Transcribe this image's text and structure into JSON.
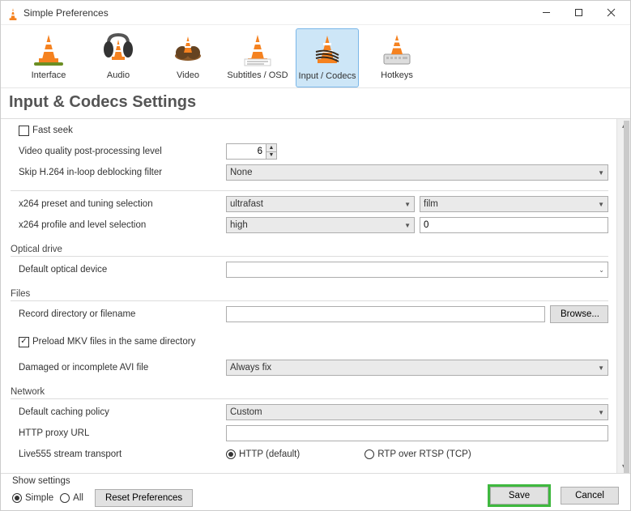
{
  "window": {
    "title": "Simple Preferences"
  },
  "categories": {
    "interface": "Interface",
    "audio": "Audio",
    "video": "Video",
    "subtitles": "Subtitles / OSD",
    "input_codecs": "Input / Codecs",
    "hotkeys": "Hotkeys"
  },
  "heading": "Input & Codecs Settings",
  "settings": {
    "fast_seek_label": "Fast seek",
    "video_quality_label": "Video quality post-processing level",
    "video_quality_value": "6",
    "skip_h264_label": "Skip H.264 in-loop deblocking filter",
    "skip_h264_value": "None",
    "x264_preset_label": "x264 preset and tuning selection",
    "x264_preset_value": "ultrafast",
    "x264_tune_value": "film",
    "x264_profile_label": "x264 profile and level selection",
    "x264_profile_value": "high",
    "x264_level_value": "0"
  },
  "optical": {
    "group": "Optical drive",
    "default_device_label": "Default optical device",
    "default_device_value": ""
  },
  "files": {
    "group": "Files",
    "record_dir_label": "Record directory or filename",
    "record_dir_value": "",
    "browse": "Browse...",
    "preload_mkv_label": "Preload MKV files in the same directory",
    "damaged_avi_label": "Damaged or incomplete AVI file",
    "damaged_avi_value": "Always fix"
  },
  "network": {
    "group": "Network",
    "caching_label": "Default caching policy",
    "caching_value": "Custom",
    "http_proxy_label": "HTTP proxy URL",
    "http_proxy_value": "",
    "live555_label": "Live555 stream transport",
    "http_default": "HTTP (default)",
    "rtp": "RTP over RTSP (TCP)"
  },
  "footer": {
    "show_settings": "Show settings",
    "simple": "Simple",
    "all": "All",
    "reset": "Reset Preferences",
    "save": "Save",
    "cancel": "Cancel"
  }
}
